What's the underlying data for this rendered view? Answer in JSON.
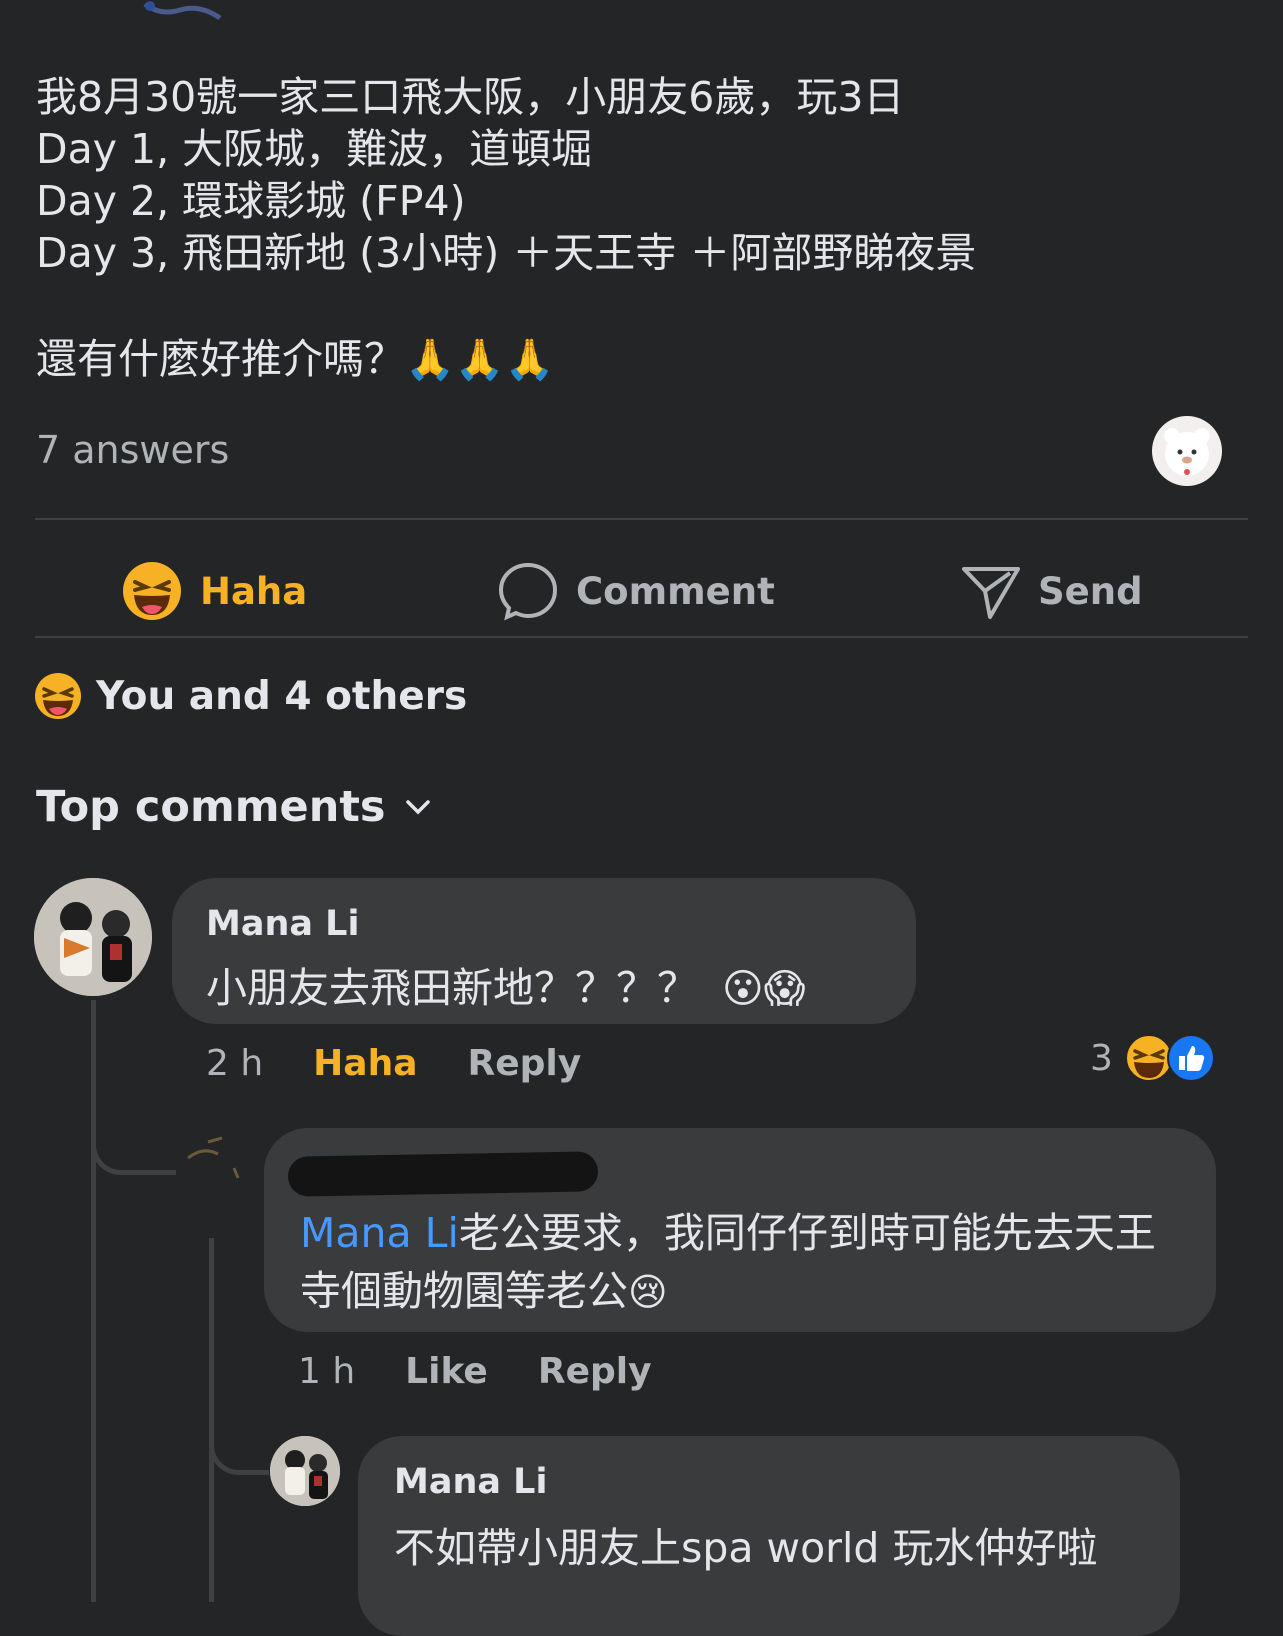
{
  "post": {
    "lines": [
      "我8月30號一家三口飛大阪，小朋友6歲，玩3日",
      "Day 1, 大阪城，難波，道頓堀",
      "Day 2, 環球影城 (FP4)",
      "Day 3, 飛田新地 (3小時) ＋天王寺 ＋阿部野睇夜景"
    ],
    "question": "還有什麼好推介嗎？",
    "question_emoji": "🙏🙏🙏",
    "answers_count": "7 answers"
  },
  "actions": {
    "haha_label": "Haha",
    "comment_label": "Comment",
    "send_label": "Send"
  },
  "reactions_summary": "You and 4 others",
  "comments_header": "Top comments",
  "comments": [
    {
      "author": "Mana Li",
      "text": "小朋友去飛田新地？？？？",
      "emoji": "😮😱",
      "time": "2 h",
      "action1": "Haha",
      "action2": "Reply",
      "reaction_count": "3"
    }
  ],
  "reply1": {
    "mention": "Mana Li",
    "text": "老公要求，我同仔仔到時可能先去天王寺個動物園等老公",
    "emoji": "😢",
    "time": "1 h",
    "action1": "Like",
    "action2": "Reply"
  },
  "reply2": {
    "author": "Mana Li",
    "text": "不如帶小朋友上spa world 玩水仲好啦"
  },
  "colors": {
    "background": "#242526",
    "bubble": "#3a3b3c",
    "haha_orange": "#f7b125",
    "mention_blue": "#4599ff",
    "like_blue": "#1877f2"
  }
}
